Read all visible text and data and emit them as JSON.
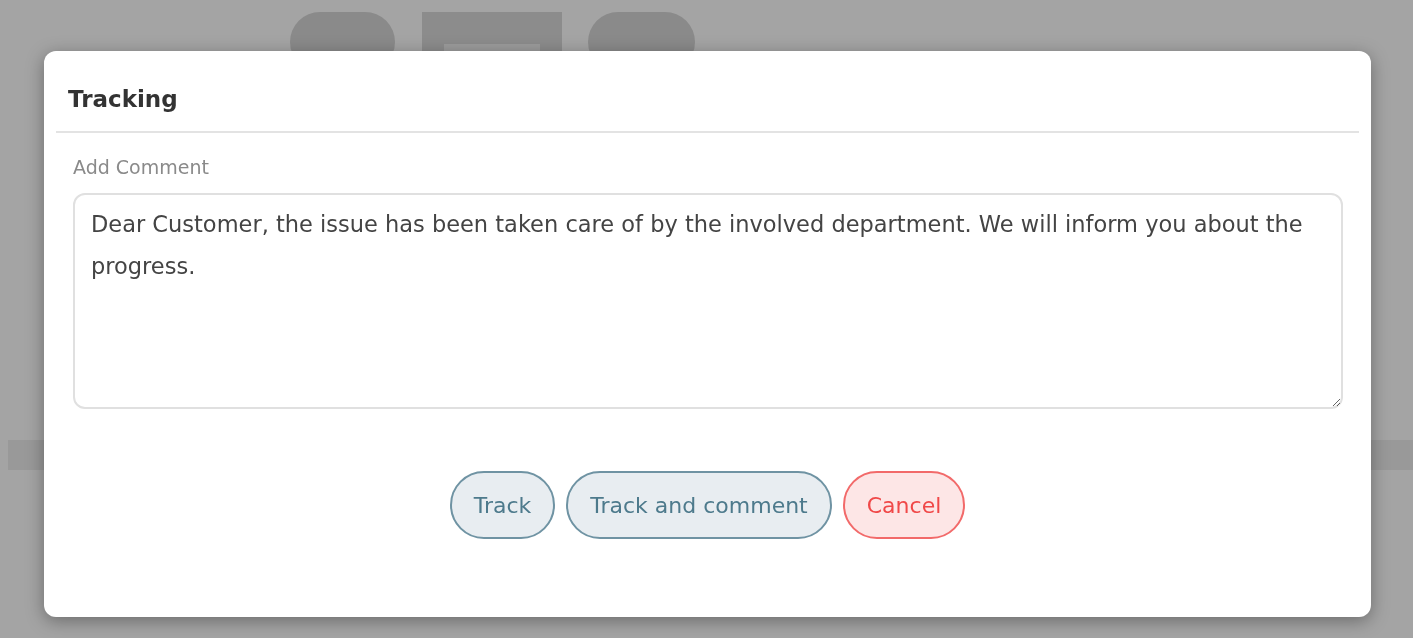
{
  "dialog": {
    "title": "Tracking"
  },
  "comment": {
    "label": "Add Comment",
    "value": "Dear Customer, the issue has been taken care of by the involved department. We will inform you about the progress."
  },
  "buttons": [
    {
      "label": "Track",
      "kind": "secondary"
    },
    {
      "label": "Track and comment",
      "kind": "secondary"
    },
    {
      "label": "Cancel",
      "kind": "danger"
    }
  ]
}
